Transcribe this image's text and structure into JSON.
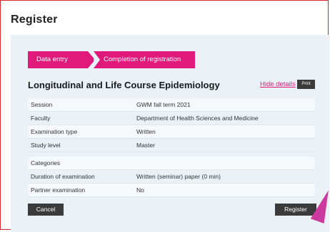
{
  "dialog": {
    "title": "Register"
  },
  "steps": [
    {
      "label": "Data entry"
    },
    {
      "label": "Completion of registration"
    }
  ],
  "course": {
    "title": "Longitudinal and Life Course Epidemiology",
    "hide_details": "Hide details",
    "print": "Print"
  },
  "details": [
    {
      "label": "Session",
      "value": "GWM fall term 2021"
    },
    {
      "label": "Faculty",
      "value": "Department of Health Sciences and Medicine"
    },
    {
      "label": "Examination type",
      "value": "Written"
    },
    {
      "label": "Study level",
      "value": "Master"
    }
  ],
  "categories": [
    {
      "label": "Categories",
      "value": ""
    },
    {
      "label": "Duration of examination",
      "value": "Written (seminar) paper (0 min)"
    },
    {
      "label": "Partner examination",
      "value": "No"
    }
  ],
  "actions": {
    "cancel": "Cancel",
    "register": "Register"
  },
  "colors": {
    "accent": "#e0197a",
    "panel_bg": "#eaf2f7",
    "button_bg": "#3b3b3b"
  }
}
